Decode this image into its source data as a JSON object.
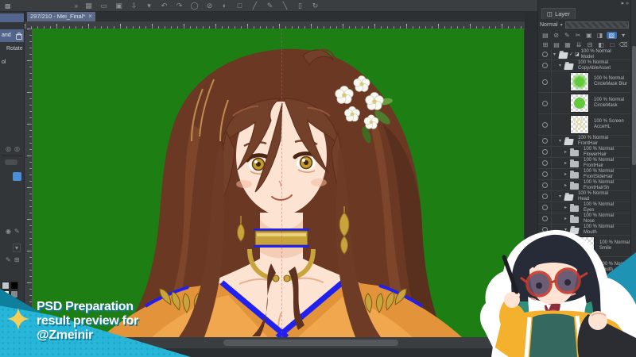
{
  "command_bar": {
    "overflow_chevron": "»",
    "icons": [
      {
        "name": "workspace-grid-icon",
        "glyph": "▦"
      },
      {
        "name": "tablet-companion-icon",
        "glyph": "▭"
      },
      {
        "name": "open-file-icon",
        "glyph": "▣"
      },
      {
        "name": "export-save-icon",
        "glyph": "⇩"
      },
      {
        "name": "save-menu-chevron-icon",
        "glyph": "▾"
      },
      {
        "name": "undo-icon",
        "glyph": "↶"
      },
      {
        "name": "redo-icon",
        "glyph": "↷"
      },
      {
        "name": "deselect-icon",
        "glyph": "◯"
      },
      {
        "name": "invert-selection-icon",
        "glyph": "⊘"
      },
      {
        "name": "selection-blend-icon",
        "glyph": "◐"
      },
      {
        "name": "marquee-icon",
        "glyph": "□"
      },
      {
        "name": "straight-line-icon",
        "glyph": "╱"
      },
      {
        "name": "pen-icon",
        "glyph": "✎"
      },
      {
        "name": "curve-line-icon",
        "glyph": "╲"
      },
      {
        "name": "device-icon",
        "glyph": "▯"
      },
      {
        "name": "rotate-view-icon",
        "glyph": "↻"
      }
    ]
  },
  "document_tab": {
    "label": "297/210 - Mei_Final*",
    "close_glyph": "×"
  },
  "left_dock": {
    "hand_item_visible_text": "and",
    "rotate_label": "Rotate",
    "partial_label": "ol",
    "icon_row_1": [
      "◎",
      "◎"
    ],
    "icon_row_3": [
      "◉",
      "✎"
    ],
    "chevron_button": "▾",
    "icon_row_5": [
      "✎",
      "⊞"
    ],
    "swatches": [
      "#c4c7c9",
      "#000000",
      "#ffffff",
      "#85888b",
      "#ff00ff",
      "#ffe000"
    ]
  },
  "canvas": {
    "background_color": "#1d7e14"
  },
  "layer_panel": {
    "panel_chevrons": "▸ »",
    "tab_label": "Layer",
    "tab_icon": "◫",
    "blend_mode": "Normal",
    "blend_chevron": "▾",
    "toolbar_row1": [
      {
        "name": "clip-to-layer-icon",
        "glyph": "▤"
      },
      {
        "name": "lock-layer-icon",
        "glyph": "⊘"
      },
      {
        "name": "lock-transparent-icon",
        "glyph": "✎"
      },
      {
        "name": "cut-icon",
        "glyph": "✂"
      },
      {
        "name": "reference-layer-icon",
        "glyph": "▣"
      },
      {
        "name": "ruler-menu-icon",
        "glyph": "◨"
      },
      {
        "name": "blue-active-icon",
        "glyph": "▧",
        "cls": "blue"
      },
      {
        "name": "menu-chevron-icon",
        "glyph": "▾"
      }
    ],
    "toolbar_row2": [
      {
        "name": "new-layer-icon",
        "glyph": "⊞"
      },
      {
        "name": "new-vector-layer-icon",
        "glyph": "▤"
      },
      {
        "name": "new-folder-icon",
        "glyph": "▦"
      },
      {
        "name": "merge-down-icon",
        "glyph": "⇊"
      },
      {
        "name": "combine-icon",
        "glyph": "⊟"
      },
      {
        "name": "layer-mask-icon",
        "glyph": "◧"
      },
      {
        "name": "apply-mask-icon",
        "glyph": "□"
      },
      {
        "name": "delete-layer-icon",
        "glyph": "⌫"
      }
    ],
    "layers": [
      {
        "arrow": "▾",
        "icon": "fold-open",
        "check": "✓",
        "special": "◪",
        "l1": "100 % Normal",
        "l2": "Model",
        "pad": "0px",
        "kind": "rf"
      },
      {
        "arrow": "▾",
        "icon": "fold-open",
        "l1": "100 % Normal",
        "l2": "CopyAbleAsset",
        "pad": "7px",
        "kind": "rf"
      },
      {
        "icon": "th-blur",
        "l1": "100 % Normal",
        "l2": "CircleMask Blur",
        "pad": "14px",
        "kind": "rt"
      },
      {
        "icon": "th-circle",
        "l1": "100 % Normal",
        "l2": "CircleMask",
        "pad": "14px",
        "kind": "rt"
      },
      {
        "icon": "th-acce",
        "l1": "100 % Screen",
        "l2": "AcceHL",
        "pad": "14px",
        "kind": "rt"
      },
      {
        "arrow": "▾",
        "icon": "fold-open",
        "l1": "100 % Normal",
        "l2": "FrontHair",
        "pad": "7px",
        "kind": "rf"
      },
      {
        "arrow": "▸",
        "icon": "fold",
        "l1": "100 % Normal",
        "l2": "FlowerHair",
        "pad": "14px",
        "kind": "rf"
      },
      {
        "arrow": "▸",
        "icon": "fold",
        "l1": "100 % Normal",
        "l2": "FrontHair",
        "pad": "14px",
        "kind": "rf"
      },
      {
        "arrow": "▸",
        "icon": "fold",
        "l1": "100 % Normal",
        "l2": "FrontSideHair",
        "pad": "14px",
        "kind": "rf"
      },
      {
        "arrow": "▸",
        "icon": "fold",
        "l1": "100 % Normal",
        "l2": "FrontHairSh",
        "pad": "14px",
        "kind": "rf"
      },
      {
        "arrow": "▾",
        "icon": "fold-open",
        "l1": "100 % Normal",
        "l2": "Head",
        "pad": "7px",
        "kind": "rf"
      },
      {
        "arrow": "▸",
        "icon": "fold",
        "l1": "100 % Normal",
        "l2": "Eyes",
        "pad": "14px",
        "kind": "rf"
      },
      {
        "arrow": "▸",
        "icon": "fold",
        "l1": "100 % Normal",
        "l2": "Nose",
        "pad": "14px",
        "kind": "rf"
      },
      {
        "arrow": "▾",
        "icon": "fold-open",
        "l1": "100 % Normal",
        "l2": "Mouth",
        "pad": "14px",
        "kind": "rf"
      },
      {
        "icon": "th-check",
        "l1": "100 % Normal",
        "l2": "Smile",
        "pad": "21px",
        "kind": "rt"
      },
      {
        "icon": "th-check",
        "l1": "100 % Normal",
        "l2": "Mouth",
        "pad": "21px",
        "kind": "rt"
      }
    ]
  },
  "banner": {
    "lines": [
      "PSD Preparation",
      "result preview for",
      "@Zmeinir"
    ],
    "cyan": "#27b6d8",
    "shadow_teal": "#0f7f9e",
    "star_yellow": "#f6cd55"
  },
  "artwork_palette": {
    "hair_brown": "#6a3823",
    "skin": "#fce3d2",
    "eye_amber": "#c49a31",
    "gold": "#c9a33c",
    "trim_blue": "#2020f0",
    "fabric_orange": "#e3933a",
    "flower_white": "#fafaf2",
    "leaf_green": "#4d7c2d"
  },
  "mascot_palette": {
    "hair_dark": "#272b37",
    "hair_teal_tips": "#2f8f7a",
    "glasses_red": "#c43a2c",
    "jacket_yellow": "#f4b12e",
    "shirt_teal": "#35695f",
    "sticker_outline": "#ffffff",
    "wedge_teal": "#1f93b4"
  }
}
